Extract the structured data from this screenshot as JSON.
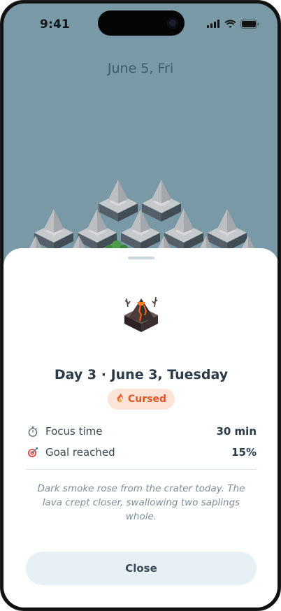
{
  "status_bar": {
    "time": "9:41"
  },
  "header": {
    "date": "June 5, Fri"
  },
  "sheet": {
    "title": "Day 3 · June 3, Tuesday",
    "badge": {
      "icon": "fire-icon",
      "label": "Cursed"
    },
    "stats": [
      {
        "icon": "stopwatch-icon",
        "label": "Focus time",
        "value": "30 min"
      },
      {
        "icon": "target-icon",
        "label": "Goal reached",
        "value": "15%"
      }
    ],
    "note": "Dark smoke rose from the crater today. The lava crept closer, swallowing two saplings whole.",
    "close_label": "Close"
  },
  "colors": {
    "background": "#7a99a6",
    "accent": "#e0582a",
    "badge_bg": "#fde3d8",
    "button_bg": "#e7f1f5"
  }
}
